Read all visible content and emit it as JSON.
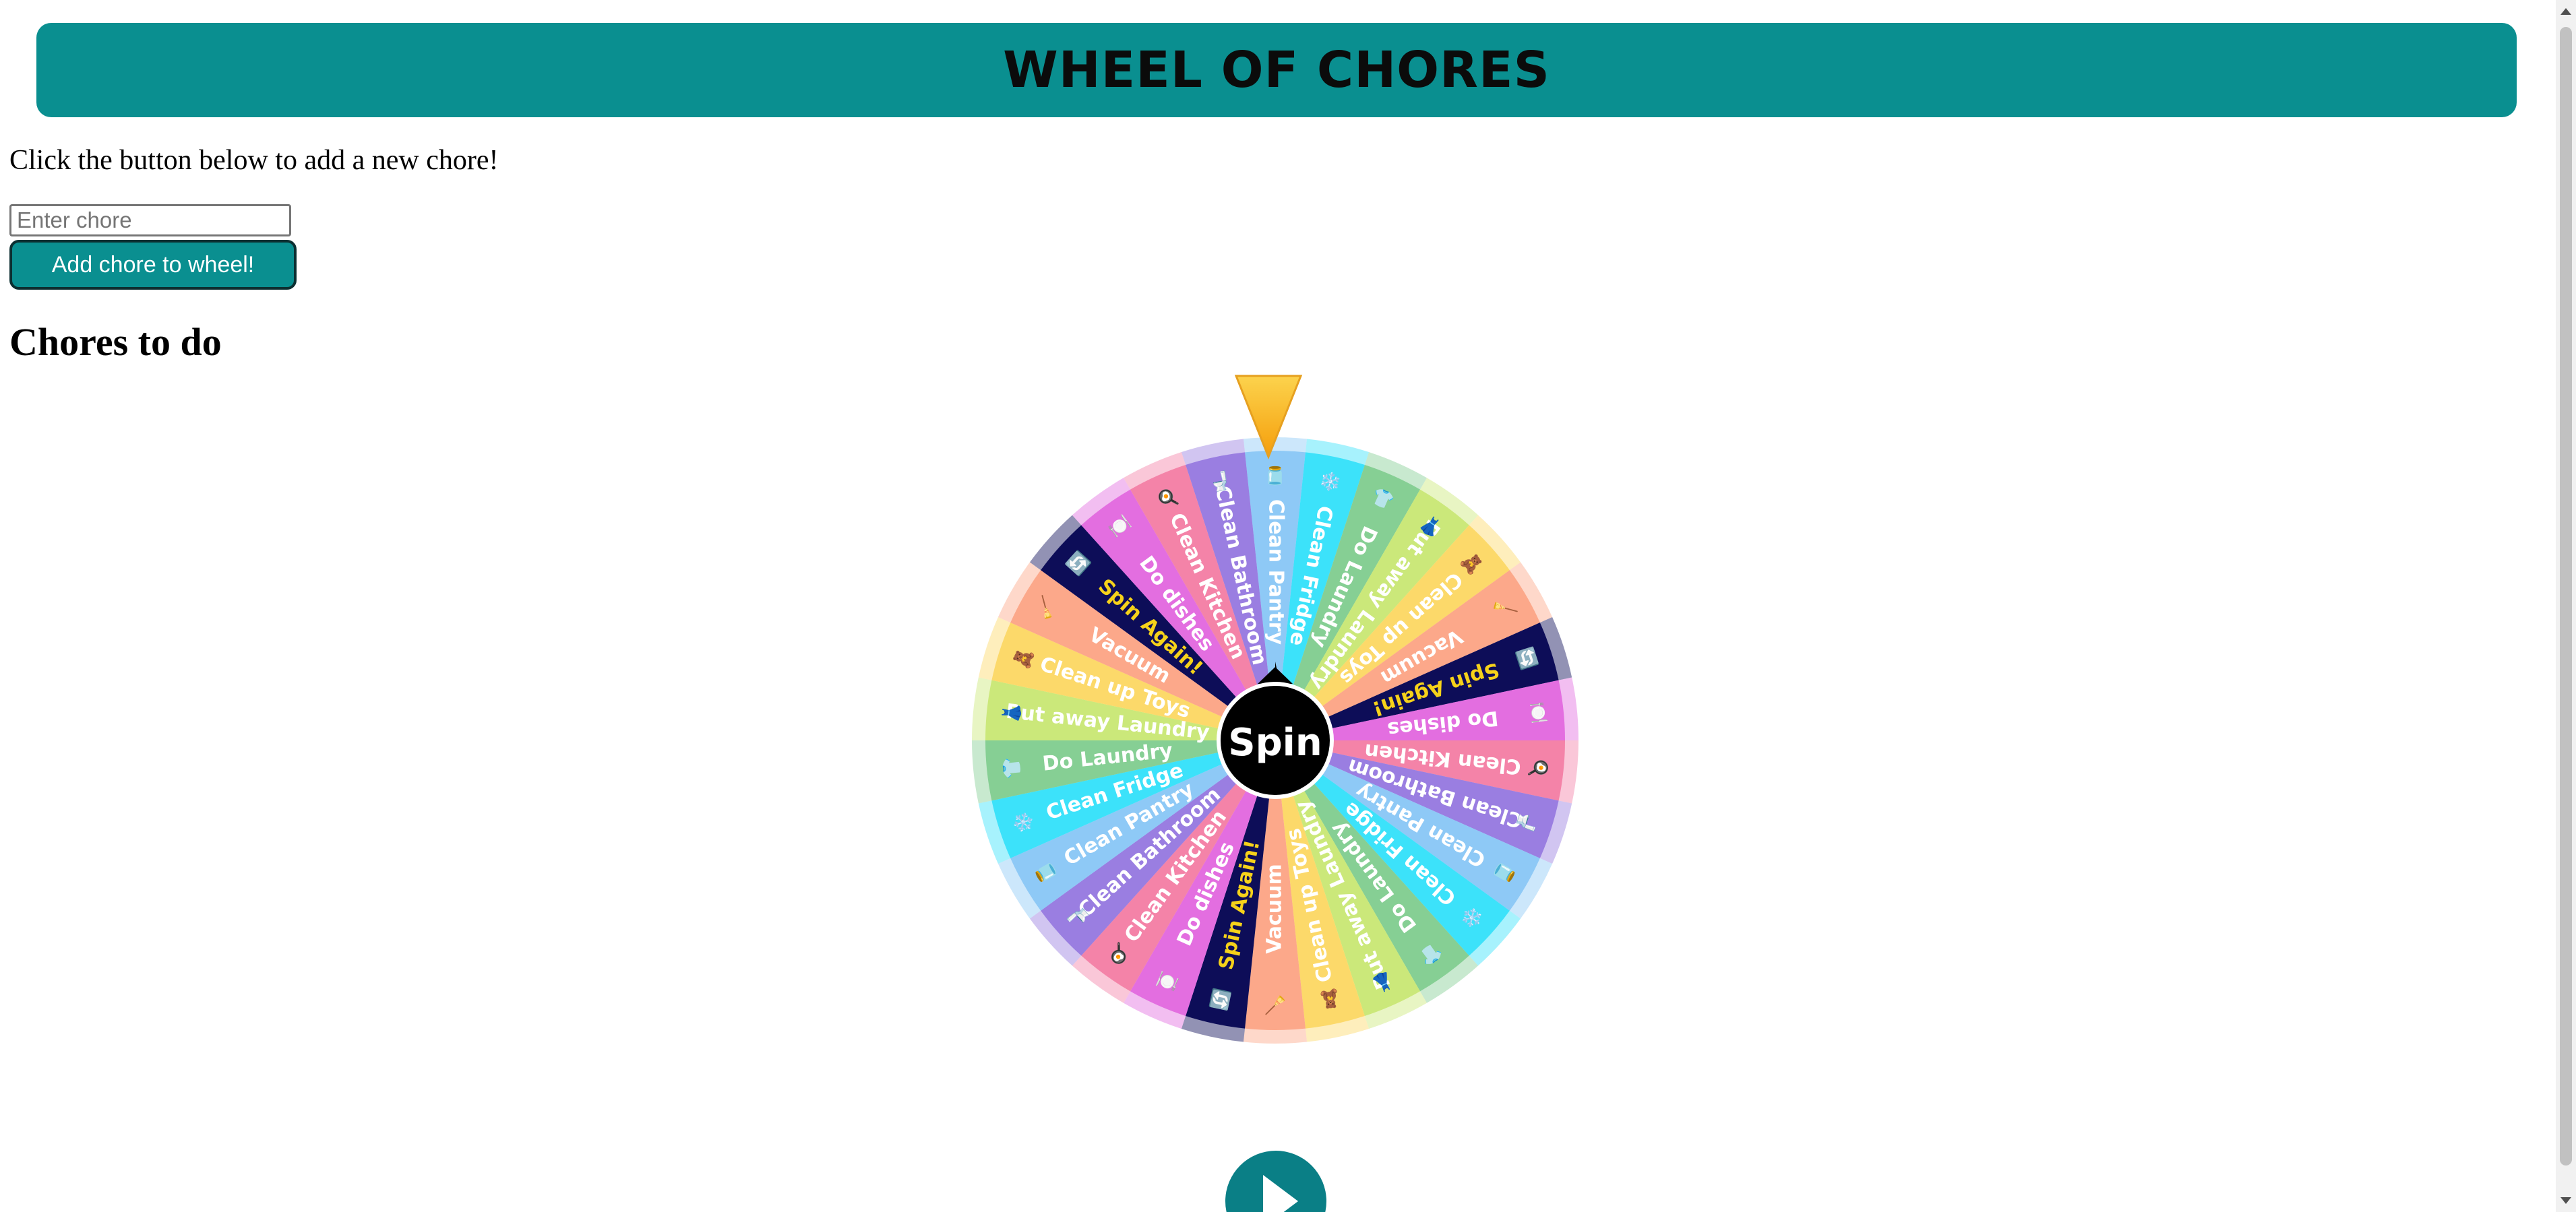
{
  "header": {
    "title": "WHEEL OF CHORES"
  },
  "intro_text": "Click the button below to add a new chore!",
  "chore_input": {
    "placeholder": "Enter chore",
    "value": ""
  },
  "add_button": {
    "label": "Add chore to wheel!"
  },
  "section_heading": "Chores to do",
  "wheel": {
    "center_label": "Spin",
    "segments": [
      {
        "label": "Clean Pantry",
        "icon": "jar-icon",
        "emoji": "🫙",
        "color": "#8ec9f6",
        "text_color": "#ffffff"
      },
      {
        "label": "Clean Fridge",
        "icon": "fridge-icon",
        "emoji": "❄️",
        "color": "#3ce2fa",
        "text_color": "#ffffff"
      },
      {
        "label": "Do Laundry",
        "icon": "laundry-icon",
        "emoji": "👕",
        "color": "#86cf94",
        "text_color": "#ffffff"
      },
      {
        "label": "Put away Laundry",
        "icon": "shirt-icon",
        "emoji": "👗",
        "color": "#cbe87a",
        "text_color": "#ffffff"
      },
      {
        "label": "Clean up Toys",
        "icon": "toy-bear-icon",
        "emoji": "🧸",
        "color": "#fcd96a",
        "text_color": "#ffffff"
      },
      {
        "label": "Vacuum",
        "icon": "vacuum-icon",
        "emoji": "🧹",
        "color": "#fca88a",
        "text_color": "#ffffff"
      },
      {
        "label": "Spin Again!",
        "icon": "repeat-icon",
        "emoji": "🔄",
        "color": "#0d0d58",
        "text_color": "#f6d21a"
      },
      {
        "label": "Do dishes",
        "icon": "plate-icon",
        "emoji": "🍽️",
        "color": "#e36ee0",
        "text_color": "#ffffff"
      },
      {
        "label": "Clean Kitchen",
        "icon": "stove-icon",
        "emoji": "🍳",
        "color": "#f483a8",
        "text_color": "#ffffff"
      },
      {
        "label": "Clean Bathroom",
        "icon": "toilet-icon",
        "emoji": "🚽",
        "color": "#9a7ee1",
        "text_color": "#ffffff"
      },
      {
        "label": "Clean Pantry",
        "icon": "jar-icon",
        "emoji": "🫙",
        "color": "#8ec9f6",
        "text_color": "#ffffff"
      },
      {
        "label": "Clean Fridge",
        "icon": "fridge-icon",
        "emoji": "❄️",
        "color": "#3ce2fa",
        "text_color": "#ffffff"
      },
      {
        "label": "Do Laundry",
        "icon": "laundry-icon",
        "emoji": "👕",
        "color": "#86cf94",
        "text_color": "#ffffff"
      },
      {
        "label": "Put away Laundry",
        "icon": "shirt-icon",
        "emoji": "👗",
        "color": "#cbe87a",
        "text_color": "#ffffff"
      },
      {
        "label": "Clean up Toys",
        "icon": "toy-bear-icon",
        "emoji": "🧸",
        "color": "#fcd96a",
        "text_color": "#ffffff"
      },
      {
        "label": "Vacuum",
        "icon": "vacuum-icon",
        "emoji": "🧹",
        "color": "#fca88a",
        "text_color": "#ffffff"
      },
      {
        "label": "Spin Again!",
        "icon": "repeat-icon",
        "emoji": "🔄",
        "color": "#0d0d58",
        "text_color": "#f6d21a"
      },
      {
        "label": "Do dishes",
        "icon": "plate-icon",
        "emoji": "🍽️",
        "color": "#e36ee0",
        "text_color": "#ffffff"
      },
      {
        "label": "Clean Kitchen",
        "icon": "stove-icon",
        "emoji": "🍳",
        "color": "#f483a8",
        "text_color": "#ffffff"
      },
      {
        "label": "Clean Bathroom",
        "icon": "toilet-icon",
        "emoji": "🚽",
        "color": "#9a7ee1",
        "text_color": "#ffffff"
      },
      {
        "label": "Clean Pantry",
        "icon": "jar-icon",
        "emoji": "🫙",
        "color": "#8ec9f6",
        "text_color": "#ffffff"
      },
      {
        "label": "Clean Fridge",
        "icon": "fridge-icon",
        "emoji": "❄️",
        "color": "#3ce2fa",
        "text_color": "#ffffff"
      },
      {
        "label": "Do Laundry",
        "icon": "laundry-icon",
        "emoji": "👕",
        "color": "#86cf94",
        "text_color": "#ffffff"
      },
      {
        "label": "Put away Laundry",
        "icon": "shirt-icon",
        "emoji": "👗",
        "color": "#cbe87a",
        "text_color": "#ffffff"
      },
      {
        "label": "Clean up Toys",
        "icon": "toy-bear-icon",
        "emoji": "🧸",
        "color": "#fcd96a",
        "text_color": "#ffffff"
      },
      {
        "label": "Vacuum",
        "icon": "vacuum-icon",
        "emoji": "🧹",
        "color": "#fca88a",
        "text_color": "#ffffff"
      },
      {
        "label": "Spin Again!",
        "icon": "repeat-icon",
        "emoji": "🔄",
        "color": "#0d0d58",
        "text_color": "#f6d21a"
      },
      {
        "label": "Do dishes",
        "icon": "plate-icon",
        "emoji": "🍽️",
        "color": "#e36ee0",
        "text_color": "#ffffff"
      },
      {
        "label": "Clean Kitchen",
        "icon": "stove-icon",
        "emoji": "🍳",
        "color": "#f483a8",
        "text_color": "#ffffff"
      },
      {
        "label": "Clean Bathroom",
        "icon": "toilet-icon",
        "emoji": "🚽",
        "color": "#9a7ee1",
        "text_color": "#ffffff"
      }
    ],
    "pointer_icon": "pointer-triangle-icon",
    "pointer_colors": [
      "#fcd34d",
      "#f59e0b"
    ]
  },
  "play_button": {
    "icon": "play-icon"
  },
  "colors": {
    "brand": "#0a8f90",
    "button_border": "#0c2f31",
    "wheel_hub": "#000000"
  }
}
